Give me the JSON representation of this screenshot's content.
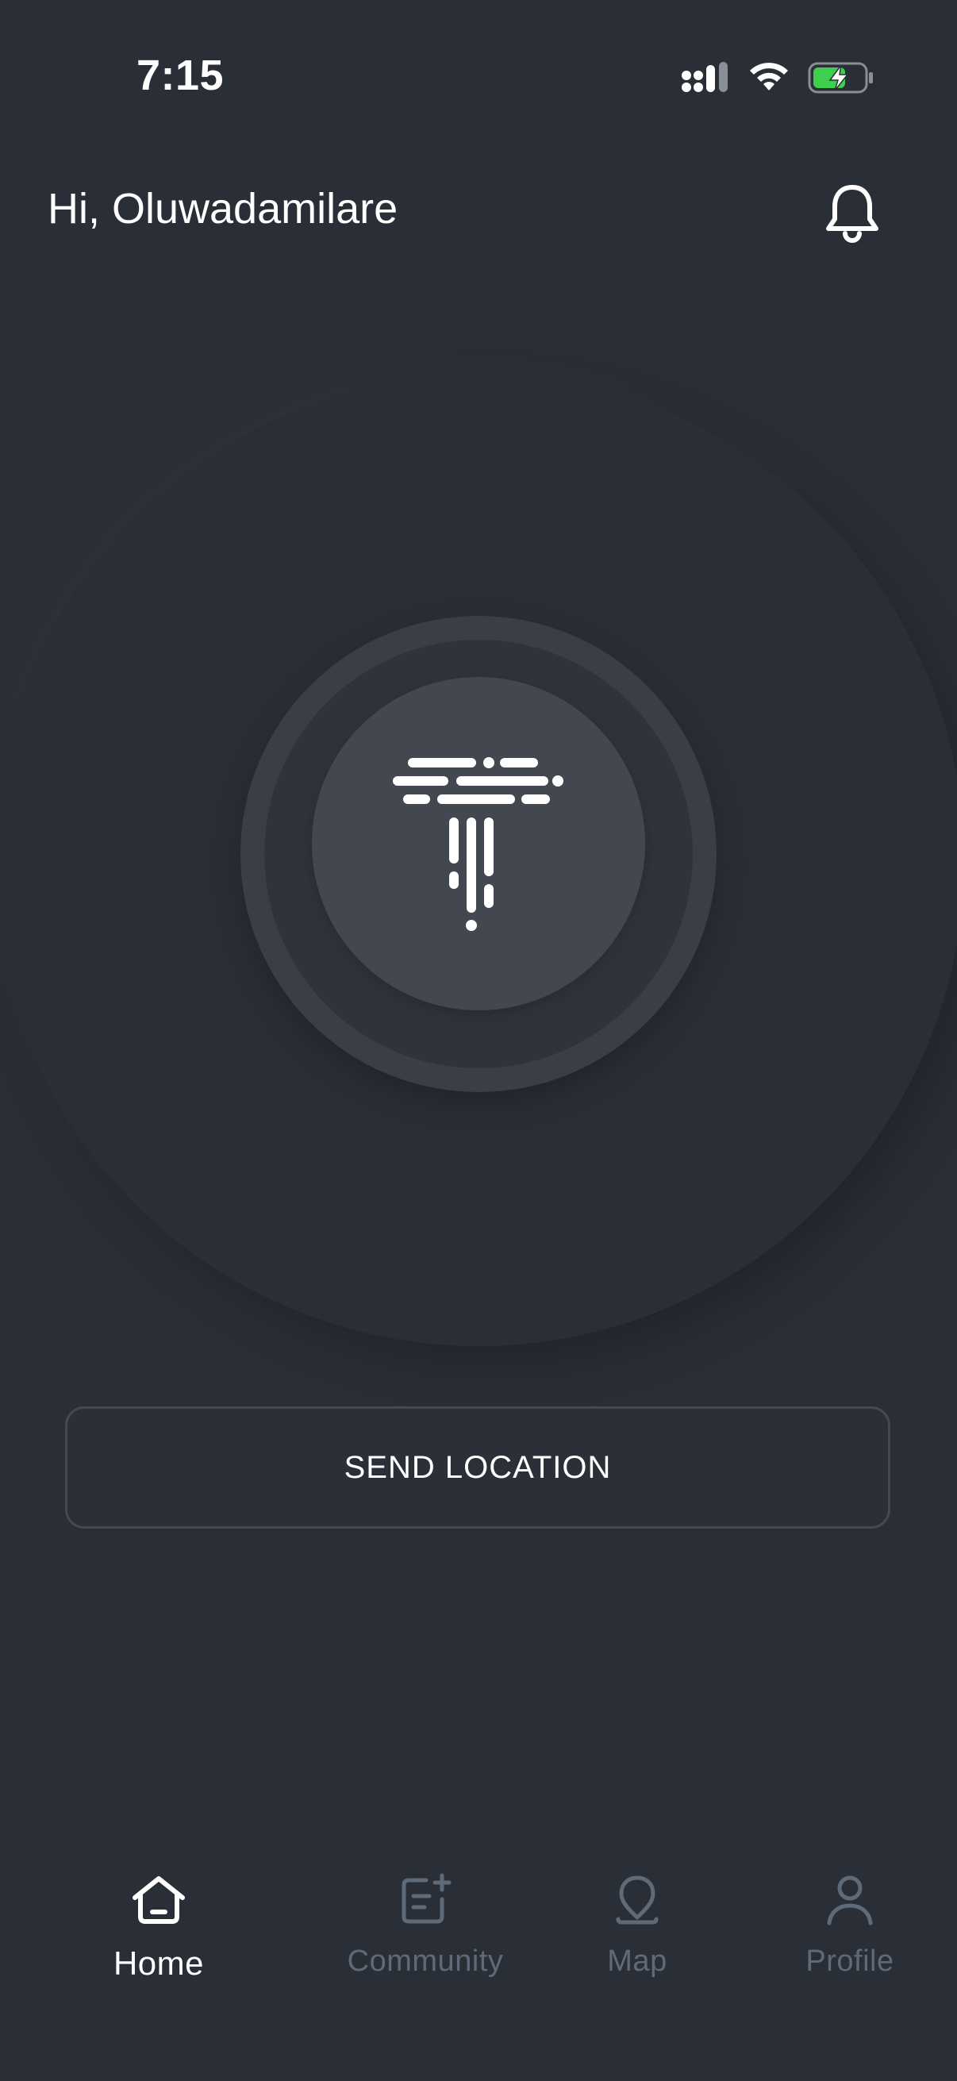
{
  "status_bar": {
    "time": "7:15"
  },
  "header": {
    "greeting": "Hi, Oluwadamilare",
    "notification_icon": "bell-icon"
  },
  "main": {
    "center_logo_icon": "t-logo-icon",
    "send_location_label": "SEND LOCATION"
  },
  "bottom_nav": {
    "items": [
      {
        "label": "Home",
        "icon": "home-icon",
        "active": true
      },
      {
        "label": "Community",
        "icon": "note-add-icon",
        "active": false
      },
      {
        "label": "Map",
        "icon": "map-pin-icon",
        "active": false
      },
      {
        "label": "Profile",
        "icon": "person-icon",
        "active": false
      }
    ]
  },
  "colors": {
    "background": "#2a2f37",
    "active_text": "#ffffff",
    "inactive_text": "#5f6a78",
    "battery_fill": "#3ecf4f"
  }
}
